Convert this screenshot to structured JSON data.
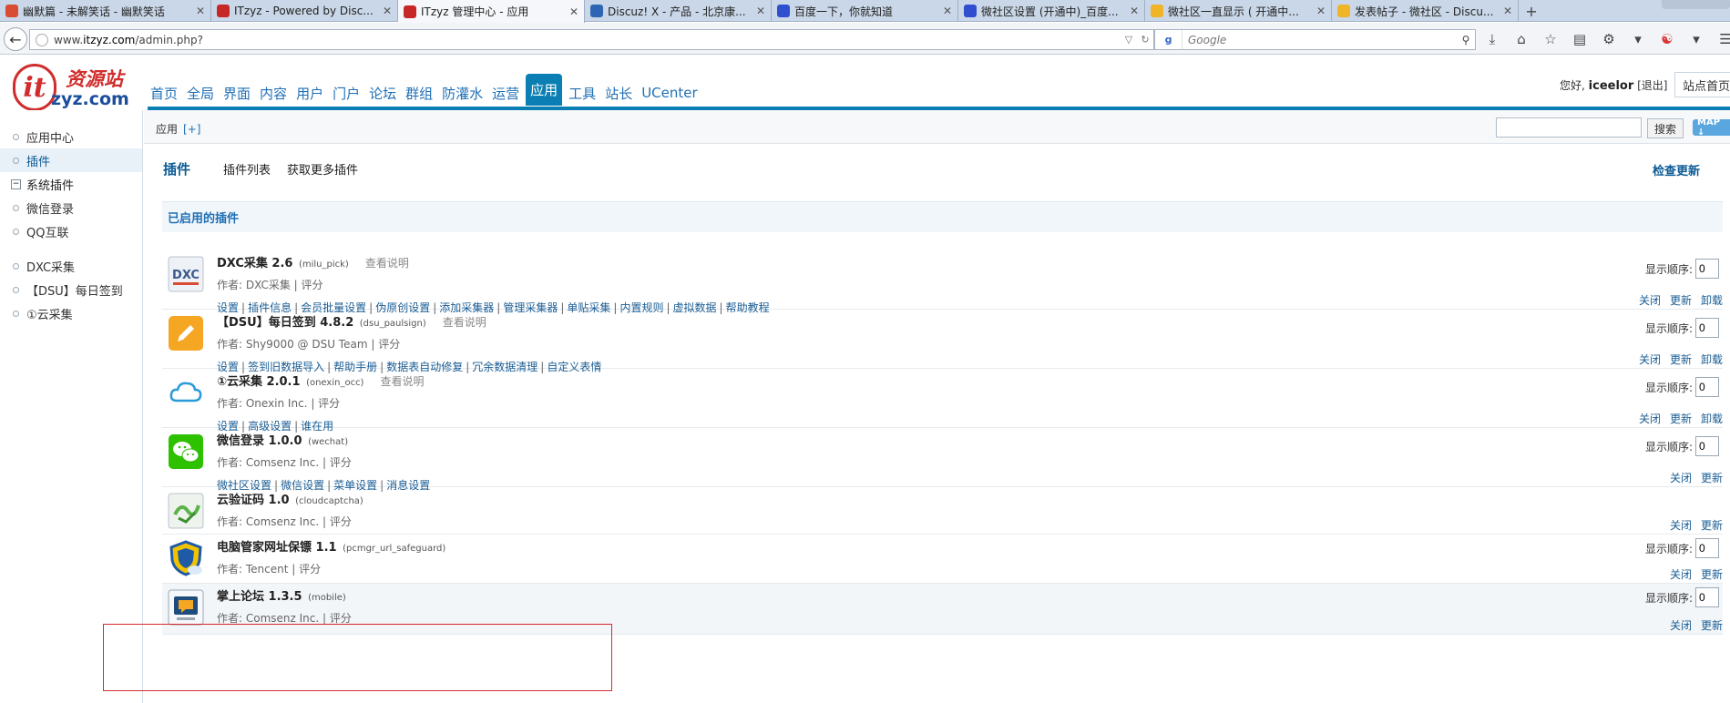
{
  "browser": {
    "tabs": [
      {
        "title": "幽默篇 - 未解笑话 - 幽默笑话",
        "favicon_color": "#d94c33",
        "width": 232
      },
      {
        "title": "ITzyz - Powered by Disc...",
        "favicon_color": "#c62828",
        "width": 205
      },
      {
        "title": "ITzyz 管理中心 - 应用",
        "favicon_color": "#c62828",
        "width": 205,
        "active": true
      },
      {
        "title": "Discuz! X - 产品 - 北京康...",
        "favicon_color": "#2f66b3",
        "width": 205
      },
      {
        "title": "百度一下，你就知道",
        "favicon_color": "#2f4fcf",
        "width": 205
      },
      {
        "title": "微社区设置 (开通中)_百度...",
        "favicon_color": "#2f4fcf",
        "width": 205
      },
      {
        "title": "微社区一直显示 ( 开通中...",
        "favicon_color": "#f0b429",
        "width": 205
      },
      {
        "title": "发表帖子 - 微社区 - Discu...",
        "favicon_color": "#f0b429",
        "width": 205
      }
    ],
    "new_tab_label": "+",
    "url_prefix": "www.",
    "url_domain": "itzyz.com",
    "url_path": "/admin.php?",
    "search_engine": "g",
    "search_placeholder": "Google"
  },
  "header": {
    "logo_it": "it",
    "logo_cn": "资源站",
    "logo_domain": "zyz.com",
    "nav": [
      "首页",
      "全局",
      "界面",
      "内容",
      "用户",
      "门户",
      "论坛",
      "群组",
      "防灌水",
      "运营",
      "应用",
      "工具",
      "站长",
      "UCenter"
    ],
    "active_nav": "应用",
    "greeting": "您好,",
    "username": "iceelor",
    "logout": "[退出]",
    "site_home": "站点首页"
  },
  "sidebar": {
    "items": [
      {
        "label": "应用中心",
        "type": "item"
      },
      {
        "label": "插件",
        "type": "item",
        "active": true
      },
      {
        "label": "系统插件",
        "type": "group"
      },
      {
        "label": "微信登录",
        "type": "item"
      },
      {
        "label": "QQ互联",
        "type": "item"
      },
      {
        "label": "DXC采集",
        "type": "item"
      },
      {
        "label": "【DSU】每日签到",
        "type": "item"
      },
      {
        "label": "①云采集",
        "type": "item"
      }
    ]
  },
  "main": {
    "breadcrumb": "应用",
    "breadcrumb_add": "[+]",
    "search_button": "搜索",
    "map_button": "MAP ↓",
    "subtab_title": "插件",
    "subtabs": [
      "插件列表",
      "获取更多插件"
    ],
    "check_update": "检查更新",
    "section_title": "已启用的插件",
    "order_label": "显示顺序:",
    "plugins": [
      {
        "name": "DXC采集 2.6",
        "ident": "(milu_pick)",
        "doc": "查看说明",
        "author": "作者: DXC采集",
        "rate": "评分",
        "links": [
          "设置",
          "插件信息",
          "会员批量设置",
          "伪原创设置",
          "添加采集器",
          "管理采集器",
          "单贴采集",
          "内置规则",
          "虚拟数据",
          "帮助教程"
        ],
        "order": "0",
        "actions": [
          "关闭",
          "更新",
          "卸载"
        ],
        "icon": "dxc"
      },
      {
        "name": "【DSU】每日签到 4.8.2",
        "ident": "(dsu_paulsign)",
        "doc": "查看说明",
        "author": "作者: Shy9000 @ DSU Team",
        "rate": "评分",
        "links": [
          "设置",
          "签到旧数据导入",
          "帮助手册",
          "数据表自动修复",
          "冗余数据清理",
          "自定义表情"
        ],
        "order": "0",
        "actions": [
          "关闭",
          "更新",
          "卸载"
        ],
        "icon": "pencil"
      },
      {
        "name": "①云采集 2.0.1",
        "ident": "(onexin_occ)",
        "doc": "查看说明",
        "author": "作者: Onexin Inc.",
        "rate": "评分",
        "links": [
          "设置",
          "高级设置",
          "谁在用"
        ],
        "order": "0",
        "actions": [
          "关闭",
          "更新",
          "卸载"
        ],
        "icon": "cloud"
      },
      {
        "name": "微信登录 1.0.0",
        "ident": "(wechat)",
        "doc": "",
        "author": "作者: Comsenz Inc.",
        "rate": "评分",
        "links": [
          "微社区设置",
          "微信设置",
          "菜单设置",
          "消息设置"
        ],
        "order": "0",
        "actions": [
          "关闭",
          "更新"
        ],
        "icon": "wechat"
      },
      {
        "name": "云验证码 1.0",
        "ident": "(cloudcaptcha)",
        "doc": "",
        "author": "作者: Comsenz Inc.",
        "rate": "评分",
        "links": [],
        "order": "",
        "actions": [
          "关闭",
          "更新"
        ],
        "icon": "captcha"
      },
      {
        "name": "电脑管家网址保镖 1.1",
        "ident": "(pcmgr_url_safeguard)",
        "doc": "",
        "author": "作者: Tencent",
        "rate": "评分",
        "links": [],
        "order": "0",
        "actions": [
          "关闭",
          "更新"
        ],
        "icon": "shield"
      },
      {
        "name": "掌上论坛 1.3.5",
        "ident": "(mobile)",
        "doc": "",
        "author": "作者: Comsenz Inc.",
        "rate": "评分",
        "links": [],
        "order": "0",
        "actions": [
          "关闭",
          "更新"
        ],
        "icon": "mobile"
      }
    ]
  }
}
